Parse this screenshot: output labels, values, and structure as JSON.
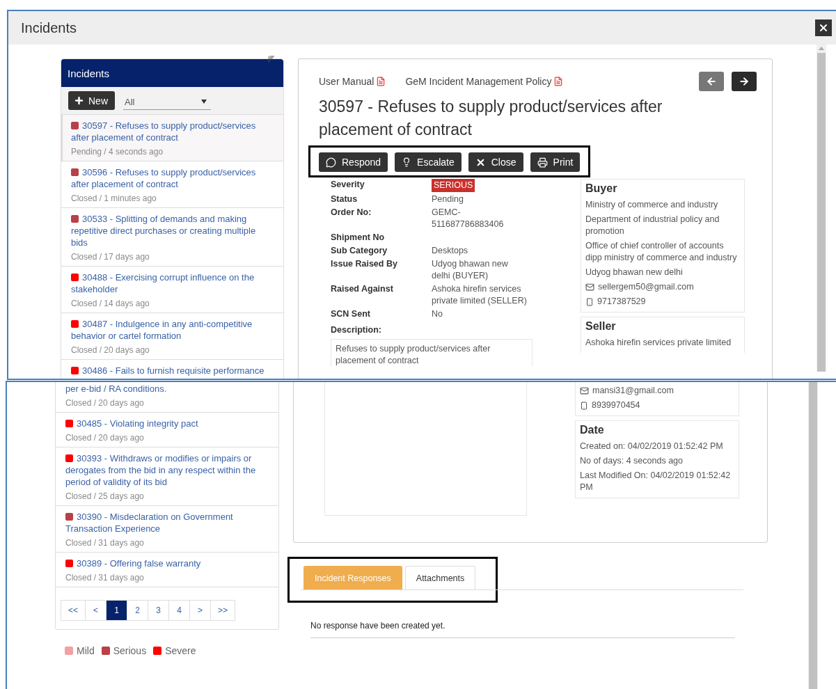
{
  "window": {
    "title": "Incidents"
  },
  "list": {
    "title": "Incidents",
    "new_button": "New",
    "filter": "All",
    "items": [
      {
        "title": "30597 - Refuses to supply product/services after placement of contract",
        "meta": "Pending / 4 seconds ago",
        "color": "#b94046",
        "selected": true
      },
      {
        "title": "30596 - Refuses to supply product/services after placement of contract",
        "meta": "Closed / 1 minutes ago",
        "color": "#b94046",
        "selected": false
      },
      {
        "title": "30533 - Splitting of demands and making repetitive direct purchases or creating multiple bids",
        "meta": "Closed / 17 days ago",
        "color": "#b94046",
        "selected": false
      },
      {
        "title": "30488 - Exercising corrupt influence on the stakeholder",
        "meta": "Closed / 14 days ago",
        "color": "#ff0000",
        "selected": false
      },
      {
        "title": "30487 - Indulgence in any anti-competitive behavior or cartel formation",
        "meta": "Closed / 20 days ago",
        "color": "#ff0000",
        "selected": false
      },
      {
        "title": "30486 - Fails to furnish requisite performance",
        "color": "#ff0000",
        "selected": false
      }
    ]
  },
  "detail": {
    "links": [
      "User Manual",
      "GeM Incident Management Policy"
    ],
    "nav": [
      {
        "kind": "prev",
        "disabled": true
      },
      {
        "kind": "next",
        "disabled": false
      }
    ],
    "title": "30597 - Refuses to supply product/services after placement of contract",
    "actions": [
      {
        "label": "Respond",
        "kind": "respond"
      },
      {
        "label": "Escalate",
        "kind": "escalate"
      },
      {
        "label": "Close",
        "kind": "close"
      },
      {
        "label": "Print",
        "kind": "print"
      }
    ],
    "fields": [
      {
        "label": "Severity",
        "value": "SERIOUS",
        "kind": "badge"
      },
      {
        "label": "Status",
        "value": "Pending",
        "kind": "text"
      },
      {
        "label": "Order No:",
        "value": "GEMC-511687786883406",
        "kind": "text"
      },
      {
        "label": "Shipment No"
      },
      {
        "label": "Sub Category",
        "value": "Desktops",
        "kind": "text"
      },
      {
        "label": "Issue Raised By",
        "value": "Udyog bhawan new delhi (BUYER)",
        "kind": "text"
      },
      {
        "label": "Raised Against",
        "value": "Ashoka hirefin services private limited (SELLER)",
        "kind": "text"
      },
      {
        "label": "SCN Sent",
        "value": "No",
        "kind": "text"
      }
    ],
    "description_label": "Description:",
    "description": "Refuses to supply product/services after placement of contract",
    "buyer": {
      "heading": "Buyer",
      "lines": [
        "Ministry of commerce and industry",
        "Department of industrial policy and promotion",
        "Office of chief controller of accounts dipp ministry of commerce and industry",
        "Udyog bhawan new delhi"
      ],
      "email": "sellergem50@gmail.com",
      "phone": "9717387529"
    },
    "seller": {
      "heading": "Seller",
      "name": "Ashoka hirefin services private limited"
    }
  },
  "continued": {
    "items": [
      {
        "kind": "tail",
        "title": "per e-bid / RA conditions.",
        "meta": "Closed / 20 days ago"
      },
      {
        "kind": "incident",
        "title": "30485 - Violating integrity pact",
        "meta": "Closed / 20 days ago",
        "color": "#ff0000"
      },
      {
        "kind": "incident",
        "title": "30393 - Withdraws or modifies or impairs or derogates from the bid in any respect within the period of validity of its bid",
        "meta": "Closed / 25 days ago",
        "color": "#ff0000"
      },
      {
        "kind": "incident",
        "title": "30390 - Misdeclaration on Government Transaction Experience",
        "meta": "Closed / 31 days ago",
        "color": "#b94046"
      },
      {
        "kind": "incident",
        "title": "30389 - Offering false warranty",
        "meta": "Closed / 31 days ago",
        "color": "#ff0000"
      }
    ],
    "pages": [
      {
        "label": "<<",
        "selected": false
      },
      {
        "label": "<",
        "selected": false
      },
      {
        "label": "1",
        "selected": true
      },
      {
        "label": "2",
        "selected": false
      },
      {
        "label": "3",
        "selected": false
      },
      {
        "label": "4",
        "selected": false
      },
      {
        "label": ">",
        "selected": false
      },
      {
        "label": ">>",
        "selected": false
      }
    ],
    "legend": [
      {
        "label": "Mild",
        "color": "#f2a0a0"
      },
      {
        "label": "Serious",
        "color": "#b94046"
      },
      {
        "label": "Severe",
        "color": "#ff0000"
      }
    ],
    "seller": {
      "email": "mansi31@gmail.com",
      "phone": "8939970454"
    },
    "date": {
      "heading": "Date",
      "lines": [
        "Created on: 04/02/2019 01:52:42 PM",
        "No of days: 4 seconds ago",
        "Last Modified On: 04/02/2019 01:52:42 PM"
      ]
    },
    "tabs": [
      {
        "label": "Incident Responses",
        "selected": true
      },
      {
        "label": "Attachments",
        "selected": false
      }
    ],
    "message": "No response have been created yet."
  }
}
